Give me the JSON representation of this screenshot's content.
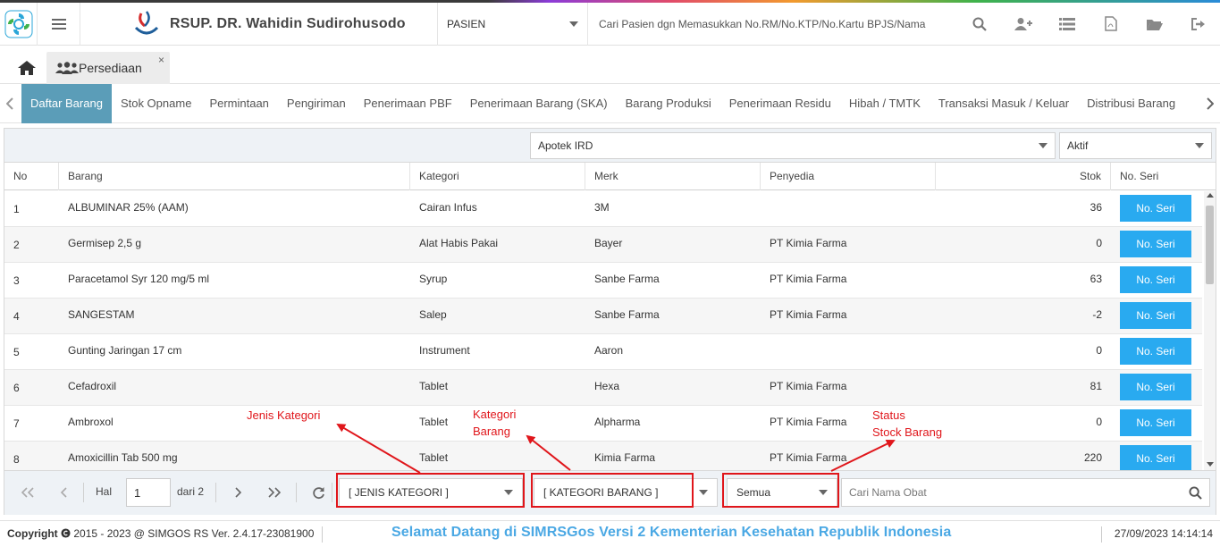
{
  "header": {
    "hospital_name": "RSUP. DR. Wahidin Sudirohusodo",
    "patient_select": "PASIEN",
    "search_placeholder": "Cari Pasien dgn Memasukkan No.RM/No.KTP/No.Kartu BPJS/Nama",
    "icons": [
      "search-icon",
      "add-user-icon",
      "list-icon",
      "pdf-icon",
      "folder-icon",
      "logout-icon"
    ]
  },
  "tabs": {
    "module_tab": "Persediaan",
    "close": "×"
  },
  "submenu": {
    "items": [
      "Daftar Barang",
      "Stok Opname",
      "Permintaan",
      "Pengiriman",
      "Penerimaan PBF",
      "Penerimaan Barang (SKA)",
      "Barang Produksi",
      "Penerimaan Residu",
      "Hibah / TMTK",
      "Transaksi Masuk / Keluar",
      "Distribusi Barang"
    ],
    "active": "Daftar Barang"
  },
  "filters": {
    "ruangan": "Apotek IRD",
    "status": "Aktif"
  },
  "table": {
    "columns": [
      "No",
      "Barang",
      "Kategori",
      "Merk",
      "Penyedia",
      "Stok",
      "No. Seri"
    ],
    "button_label": "No. Seri",
    "rows": [
      {
        "no": "1",
        "barang": "ALBUMINAR 25% (AAM)",
        "kategori": "Cairan Infus",
        "merk": "3M",
        "penyedia": "",
        "stok": "36"
      },
      {
        "no": "2",
        "barang": "Germisep 2,5 g",
        "kategori": "Alat Habis Pakai",
        "merk": "Bayer",
        "penyedia": "PT Kimia Farma",
        "stok": "0"
      },
      {
        "no": "3",
        "barang": "Paracetamol Syr 120 mg/5 ml",
        "kategori": "Syrup",
        "merk": "Sanbe Farma",
        "penyedia": "PT Kimia Farma",
        "stok": "63"
      },
      {
        "no": "4",
        "barang": "SANGESTAM",
        "kategori": "Salep",
        "merk": "Sanbe Farma",
        "penyedia": "PT Kimia Farma",
        "stok": "-2"
      },
      {
        "no": "5",
        "barang": "Gunting Jaringan 17 cm",
        "kategori": "Instrument",
        "merk": "Aaron",
        "penyedia": "",
        "stok": "0"
      },
      {
        "no": "6",
        "barang": "Cefadroxil",
        "kategori": "Tablet",
        "merk": "Hexa",
        "penyedia": "PT Kimia Farma",
        "stok": "81"
      },
      {
        "no": "7",
        "barang": "Ambroxol",
        "kategori": "Tablet",
        "merk": "Alpharma",
        "penyedia": "PT Kimia Farma",
        "stok": "0"
      },
      {
        "no": "8",
        "barang": "Amoxicillin Tab 500 mg",
        "kategori": "Tablet",
        "merk": "Kimia Farma",
        "penyedia": "PT Kimia Farma",
        "stok": "220"
      }
    ]
  },
  "pager": {
    "hal_label": "Hal",
    "page": "1",
    "of_label": "dari 2",
    "jenis_kategori": "[ JENIS KATEGORI ]",
    "kategori_barang": "[ KATEGORI BARANG ]",
    "status_stock": "Semua",
    "search_placeholder": "Cari Nama Obat"
  },
  "annotations": {
    "jenis": "Jenis Kategori",
    "kategori_line1": "Kategori",
    "kategori_line2": "Barang",
    "status_line1": "Status",
    "status_line2": "Stock Barang",
    "color": "#e0161b"
  },
  "footer": {
    "copyright": "2015 - 2023 @ SIMGOS RS Ver. 2.4.17-23081900",
    "copyright_label": "Copyright",
    "welcome": "Selamat Datang di SIMRSGos Versi 2 Kementerian Kesehatan Republik Indonesia",
    "datetime": "27/09/2023 14:14:14"
  },
  "colors": {
    "active_tab": "#5b9db8",
    "button": "#29aaf0",
    "welcome": "#4aa8e4"
  }
}
